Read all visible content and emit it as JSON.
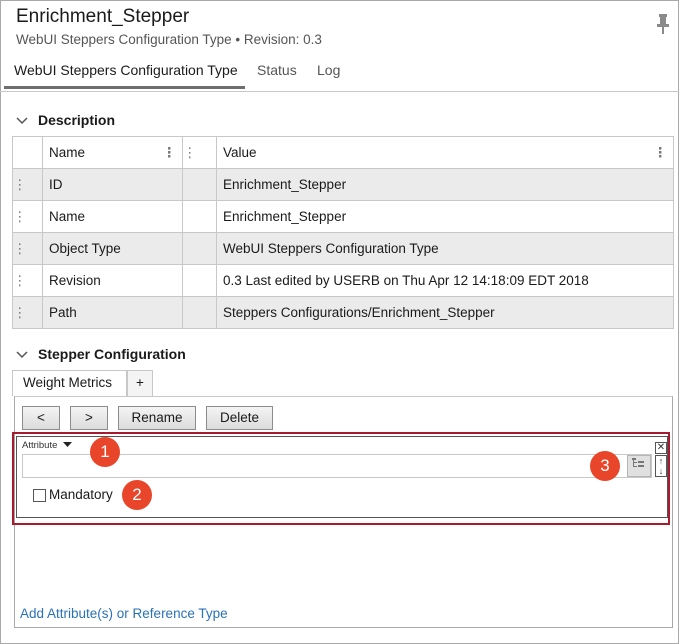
{
  "header": {
    "title": "Enrichment_Stepper",
    "subtitle": "WebUI Steppers Configuration Type • Revision: 0.3",
    "pin_icon": "pin-icon"
  },
  "tabs": [
    {
      "label": "WebUI Steppers Configuration Type",
      "active": true
    },
    {
      "label": "Status",
      "active": false
    },
    {
      "label": "Log",
      "active": false
    }
  ],
  "description": {
    "title": "Description",
    "columns": {
      "name": "Name",
      "value": "Value"
    },
    "rows": [
      {
        "name": "ID",
        "value": "Enrichment_Stepper"
      },
      {
        "name": "Name",
        "value": "Enrichment_Stepper"
      },
      {
        "name": "Object Type",
        "value": "WebUI Steppers Configuration Type"
      },
      {
        "name": "Revision",
        "value": "0.3 Last edited by USERB on Thu Apr 12 14:18:09 EDT 2018"
      },
      {
        "name": "Path",
        "value": "Steppers Configurations/Enrichment_Stepper"
      }
    ]
  },
  "stepper": {
    "title": "Stepper Configuration",
    "subtab_label": "Weight Metrics",
    "add_tab_label": "+",
    "buttons": {
      "prev": "<",
      "next": ">",
      "rename": "Rename",
      "delete": "Delete"
    },
    "attribute_label": "Attribute",
    "attribute_value": "",
    "mandatory_label": "Mandatory",
    "mandatory_checked": false,
    "add_link": "Add Attribute(s) or Reference Type"
  },
  "callouts": {
    "one": "1",
    "two": "2",
    "three": "3"
  },
  "colors": {
    "callout": "#e8452a",
    "highlight_border": "#a61c2e",
    "link": "#2a72b8"
  }
}
